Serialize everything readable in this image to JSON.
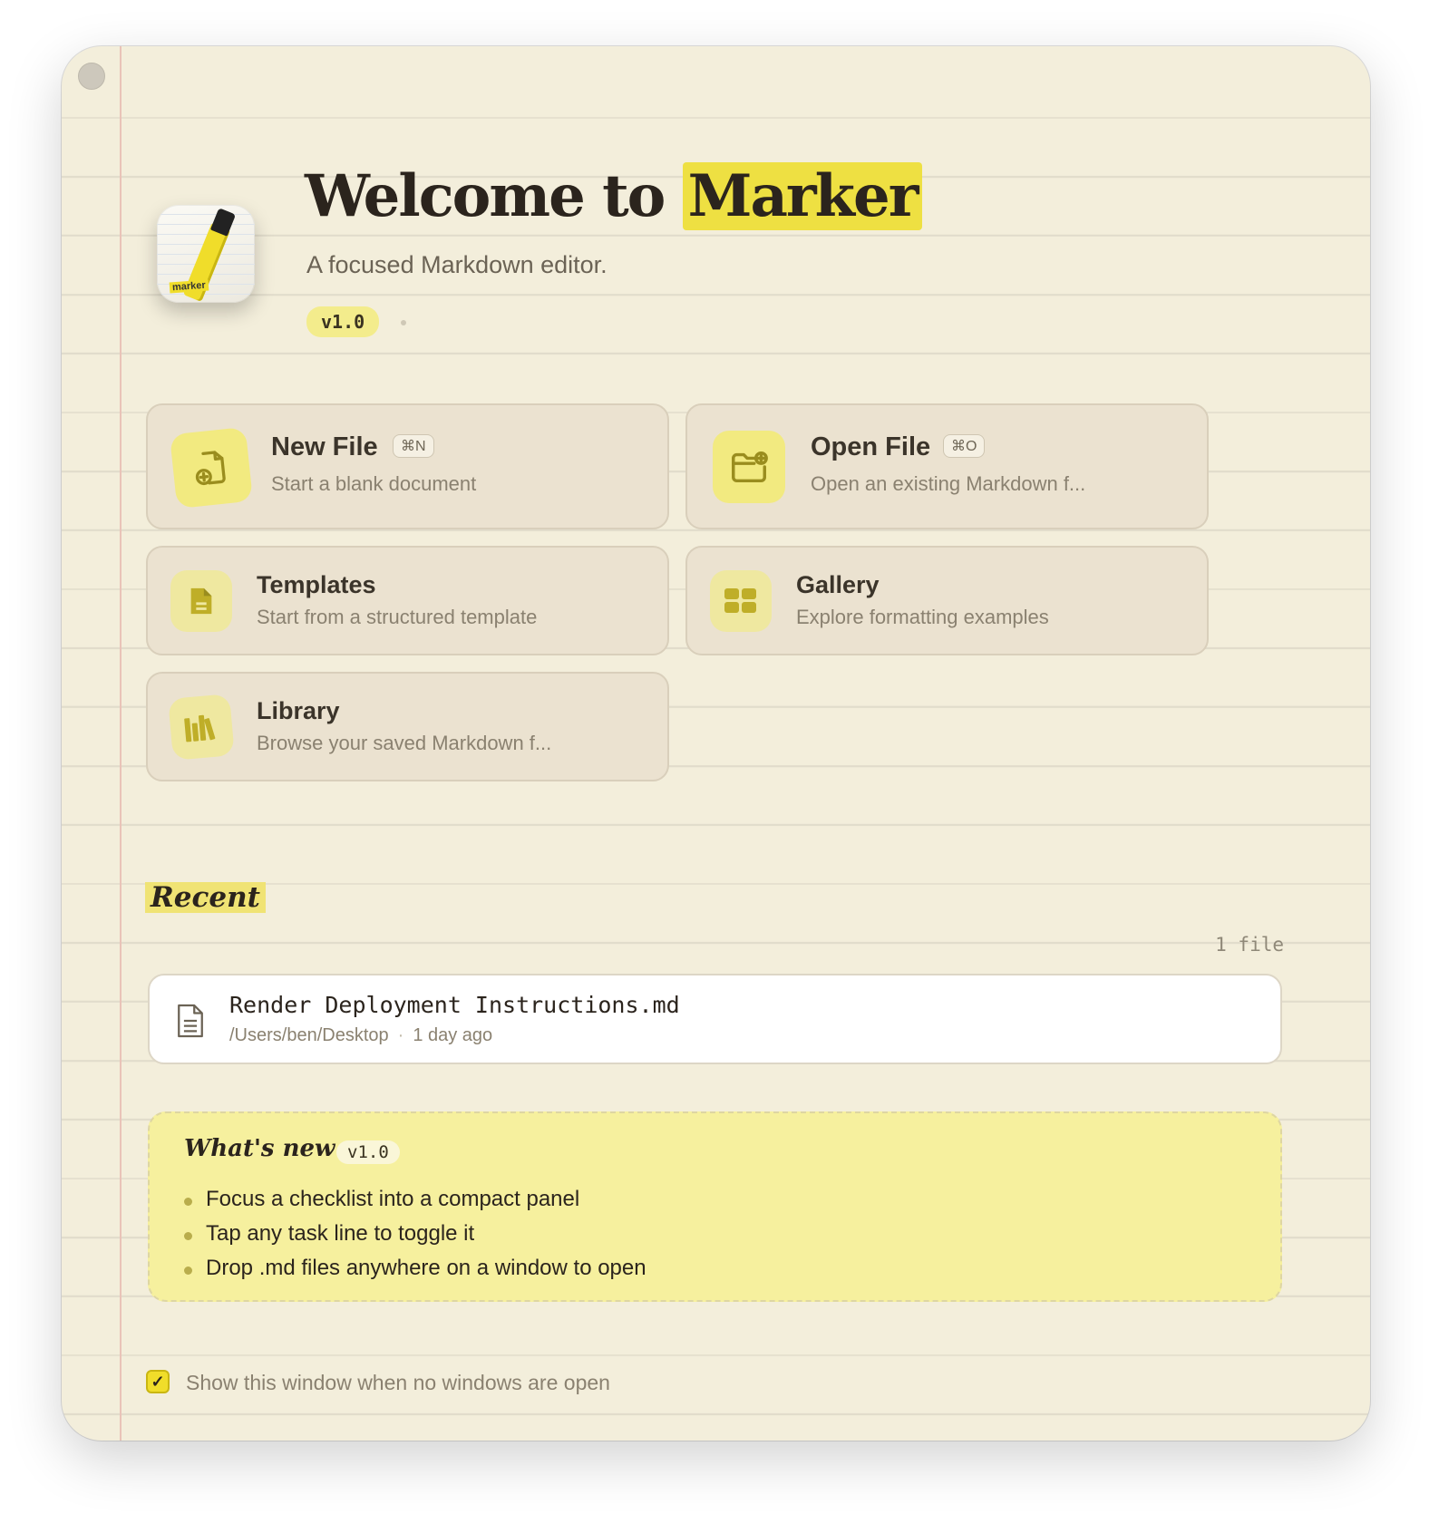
{
  "header": {
    "title_prefix": "Welcome to",
    "title_highlight": "Marker",
    "subtitle": "A focused Markdown editor.",
    "version": "v1.0",
    "icon_label": "marker"
  },
  "actions": {
    "new_file": {
      "title": "New File",
      "shortcut": "⌘N",
      "description": "Start a blank document",
      "icon": "new-file-icon"
    },
    "open_file": {
      "title": "Open File",
      "shortcut": "⌘O",
      "description": "Open an existing Markdown f...",
      "icon": "open-folder-icon"
    },
    "templates": {
      "title": "Templates",
      "description": "Start from a structured template",
      "icon": "document-icon"
    },
    "gallery": {
      "title": "Gallery",
      "description": "Explore formatting examples",
      "icon": "grid-icon"
    },
    "library": {
      "title": "Library",
      "description": "Browse your saved Markdown f...",
      "icon": "books-icon"
    }
  },
  "recent": {
    "title": "Recent",
    "count": "1 file",
    "files": [
      {
        "name": "Render Deployment Instructions.md",
        "path": "/Users/ben/Desktop",
        "time": "1 day ago"
      }
    ]
  },
  "whats_new": {
    "title": "What's new",
    "version": "v1.0",
    "items": [
      "Focus a checklist into a compact panel",
      "Tap any task line to toggle it",
      "Drop .md files anywhere on a window to open"
    ]
  },
  "footer": {
    "checkbox_checked": true,
    "checkbox_mark": "✓",
    "checkbox_label": "Show this window when no windows are open"
  },
  "colors": {
    "background": "#f3eedb",
    "accent_yellow": "#f0dd2a",
    "card": "#ebe2d0",
    "text": "#2b241d"
  }
}
